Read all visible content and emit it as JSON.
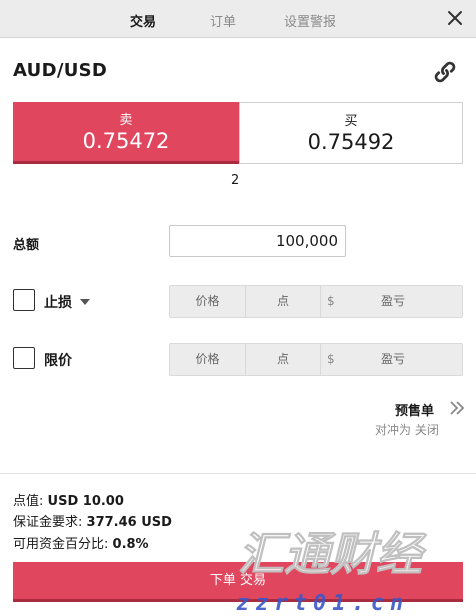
{
  "tabs": [
    {
      "label": "交易",
      "active": true
    },
    {
      "label": "订单",
      "active": false
    },
    {
      "label": "设置警报",
      "active": false
    }
  ],
  "icons": {
    "close": "close-icon",
    "link": "link-icon",
    "chevrons": "double-chevron-right-icon",
    "dropdown": "caret-down-icon"
  },
  "instrument": {
    "symbol": "AUD/USD"
  },
  "sell": {
    "label": "卖",
    "price": "0.75472",
    "color": "#e0475f"
  },
  "buy": {
    "label": "买",
    "price": "0.75492"
  },
  "spread": "2",
  "amount": {
    "label": "总额",
    "value": "100,000"
  },
  "stop_loss": {
    "label": "止损",
    "checked": false,
    "price_placeholder": "价格",
    "pips_placeholder": "点",
    "currency": "$",
    "pl_placeholder": "盈亏"
  },
  "limit": {
    "label": "限价",
    "checked": false,
    "price_placeholder": "价格",
    "pips_placeholder": "点",
    "currency": "$",
    "pl_placeholder": "盈亏"
  },
  "pending_order": {
    "label": "预售单",
    "oco_label": "对冲为 关闭"
  },
  "info": {
    "pip_value_label": "点值:",
    "pip_value": "USD 10.00",
    "margin_label": "保证金要求:",
    "margin": "377.46 USD",
    "available_label": "可用资金百分比:",
    "available": "0.8%"
  },
  "place_order_label": "下单 交易",
  "watermark": {
    "text": "汇通财经",
    "url": "zzrt01.cn"
  }
}
